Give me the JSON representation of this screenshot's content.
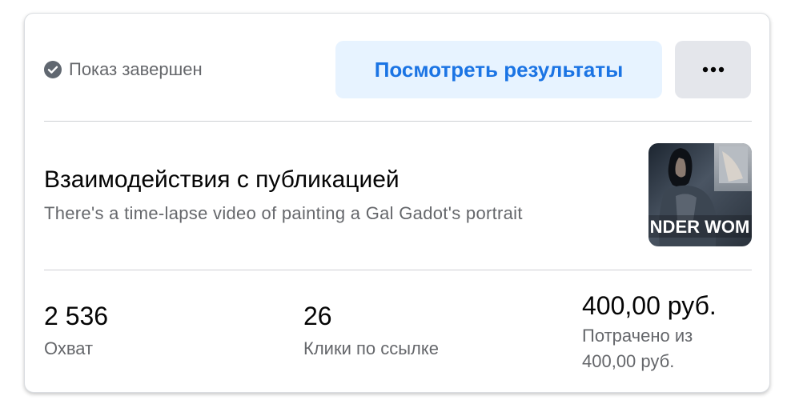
{
  "status": {
    "icon": "check-circle-icon",
    "text": "Показ завершен"
  },
  "actions": {
    "view_results_label": "Посмотреть результаты",
    "more_icon": "more-horizontal-icon"
  },
  "post": {
    "title": "Взаимодействия с публикацией",
    "description": "There's a time-lapse video of painting a Gal Gadot's portrait",
    "thumbnail_text": "NDER WOM"
  },
  "metrics": {
    "reach": {
      "value": "2 536",
      "label": "Охват"
    },
    "clicks": {
      "value": "26",
      "label": "Клики по ссылке"
    },
    "spend": {
      "value": "400,00 руб.",
      "label_line1": "Потрачено из",
      "label_line2": "400,00 руб."
    }
  },
  "colors": {
    "accent": "#1b74e4",
    "accent_bg": "#e7f3ff",
    "secondary_text": "#65676b",
    "primary_text": "#050505"
  }
}
